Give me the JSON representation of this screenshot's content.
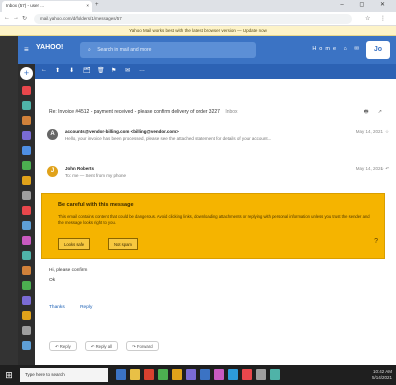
{
  "browser": {
    "tab_title": "Inbox (57) - user ...",
    "tab_close": "×",
    "new_tab": "+",
    "window_controls": "– ◻ ✕",
    "address": "mail.yahoo.com/d/folders/1/messages/57",
    "toolbar_icons": "☆ ⋮",
    "notice": "Yahoo Mail works best with the latest browser version — Update now"
  },
  "header": {
    "menu_glyph": "≡",
    "logo": "YAHOO!",
    "search_placeholder": "Search in mail and more",
    "search_icon": "search-icon",
    "right_items": "Home  ⌂  ✉",
    "account_initials": "Jo"
  },
  "sidebar": {
    "compose_glyph": "+",
    "icon_colors": [
      "#e8474c",
      "#4fb3a8",
      "#d0813a",
      "#7a6bd4",
      "#4f8fe3",
      "#4caf50",
      "#e0a21a",
      "#9e9e9e",
      "#e8474c",
      "#5e9fd6",
      "#c95ac0",
      "#4fb3a8",
      "#d0813a",
      "#4caf50",
      "#7a6bd4",
      "#e0a21a",
      "#9e9e9e",
      "#5e9fd6"
    ]
  },
  "actions": [
    "←",
    "⬆",
    "⬇",
    "🗂",
    "🗑",
    "⚑",
    "✉",
    "…"
  ],
  "message": {
    "subject": "Re: Invoice #4512 - payment received - please confirm delivery of order 3227",
    "folder": "Inbox",
    "subject_icons": "🖶 ↗",
    "thread": [
      {
        "initial": "A",
        "avatar_color": "#666666",
        "from": "accounts@vendor-billing.com  <billing@vendor.com>",
        "snippet": "Hello, your invoice has been processed, please see the attached statement for details of your account...",
        "date": "May 14, 2021",
        "star": "☆"
      },
      {
        "initial": "J",
        "avatar_color": "#e0a21a",
        "from": "John Roberts",
        "snippet": "To: me  — Sent from my phone",
        "date": "May 14, 2021",
        "star": "☆ ↶"
      }
    ],
    "warning": {
      "title": "Be careful with this message",
      "text": "This email contains content that could be dangerous. Avoid clicking links, downloading attachments or replying with personal information unless you trust the sender and the message looks right to you.",
      "buttons": [
        "Looks safe",
        "Not spam"
      ],
      "help_glyph": "?"
    },
    "body_lines": [
      "Hi, please confirm",
      "Ok"
    ],
    "links": [
      "Thanks",
      "Reply"
    ],
    "reply_buttons": [
      "↶ Reply",
      "↶ Reply all",
      "↷ Forward"
    ]
  },
  "taskbar": {
    "start_glyph": "⊞",
    "search_text": "Type here to search",
    "app_colors": [
      "#3b73c4",
      "#e8c046",
      "#d9412f",
      "#4caf50",
      "#e0a21a",
      "#7a6bd4",
      "#3b73c4",
      "#c95ac0",
      "#2d9cdb",
      "#e8474c",
      "#9e9e9e",
      "#4fb3a8"
    ],
    "tray_time": "10:42 AM",
    "tray_date": "5/14/2021"
  }
}
